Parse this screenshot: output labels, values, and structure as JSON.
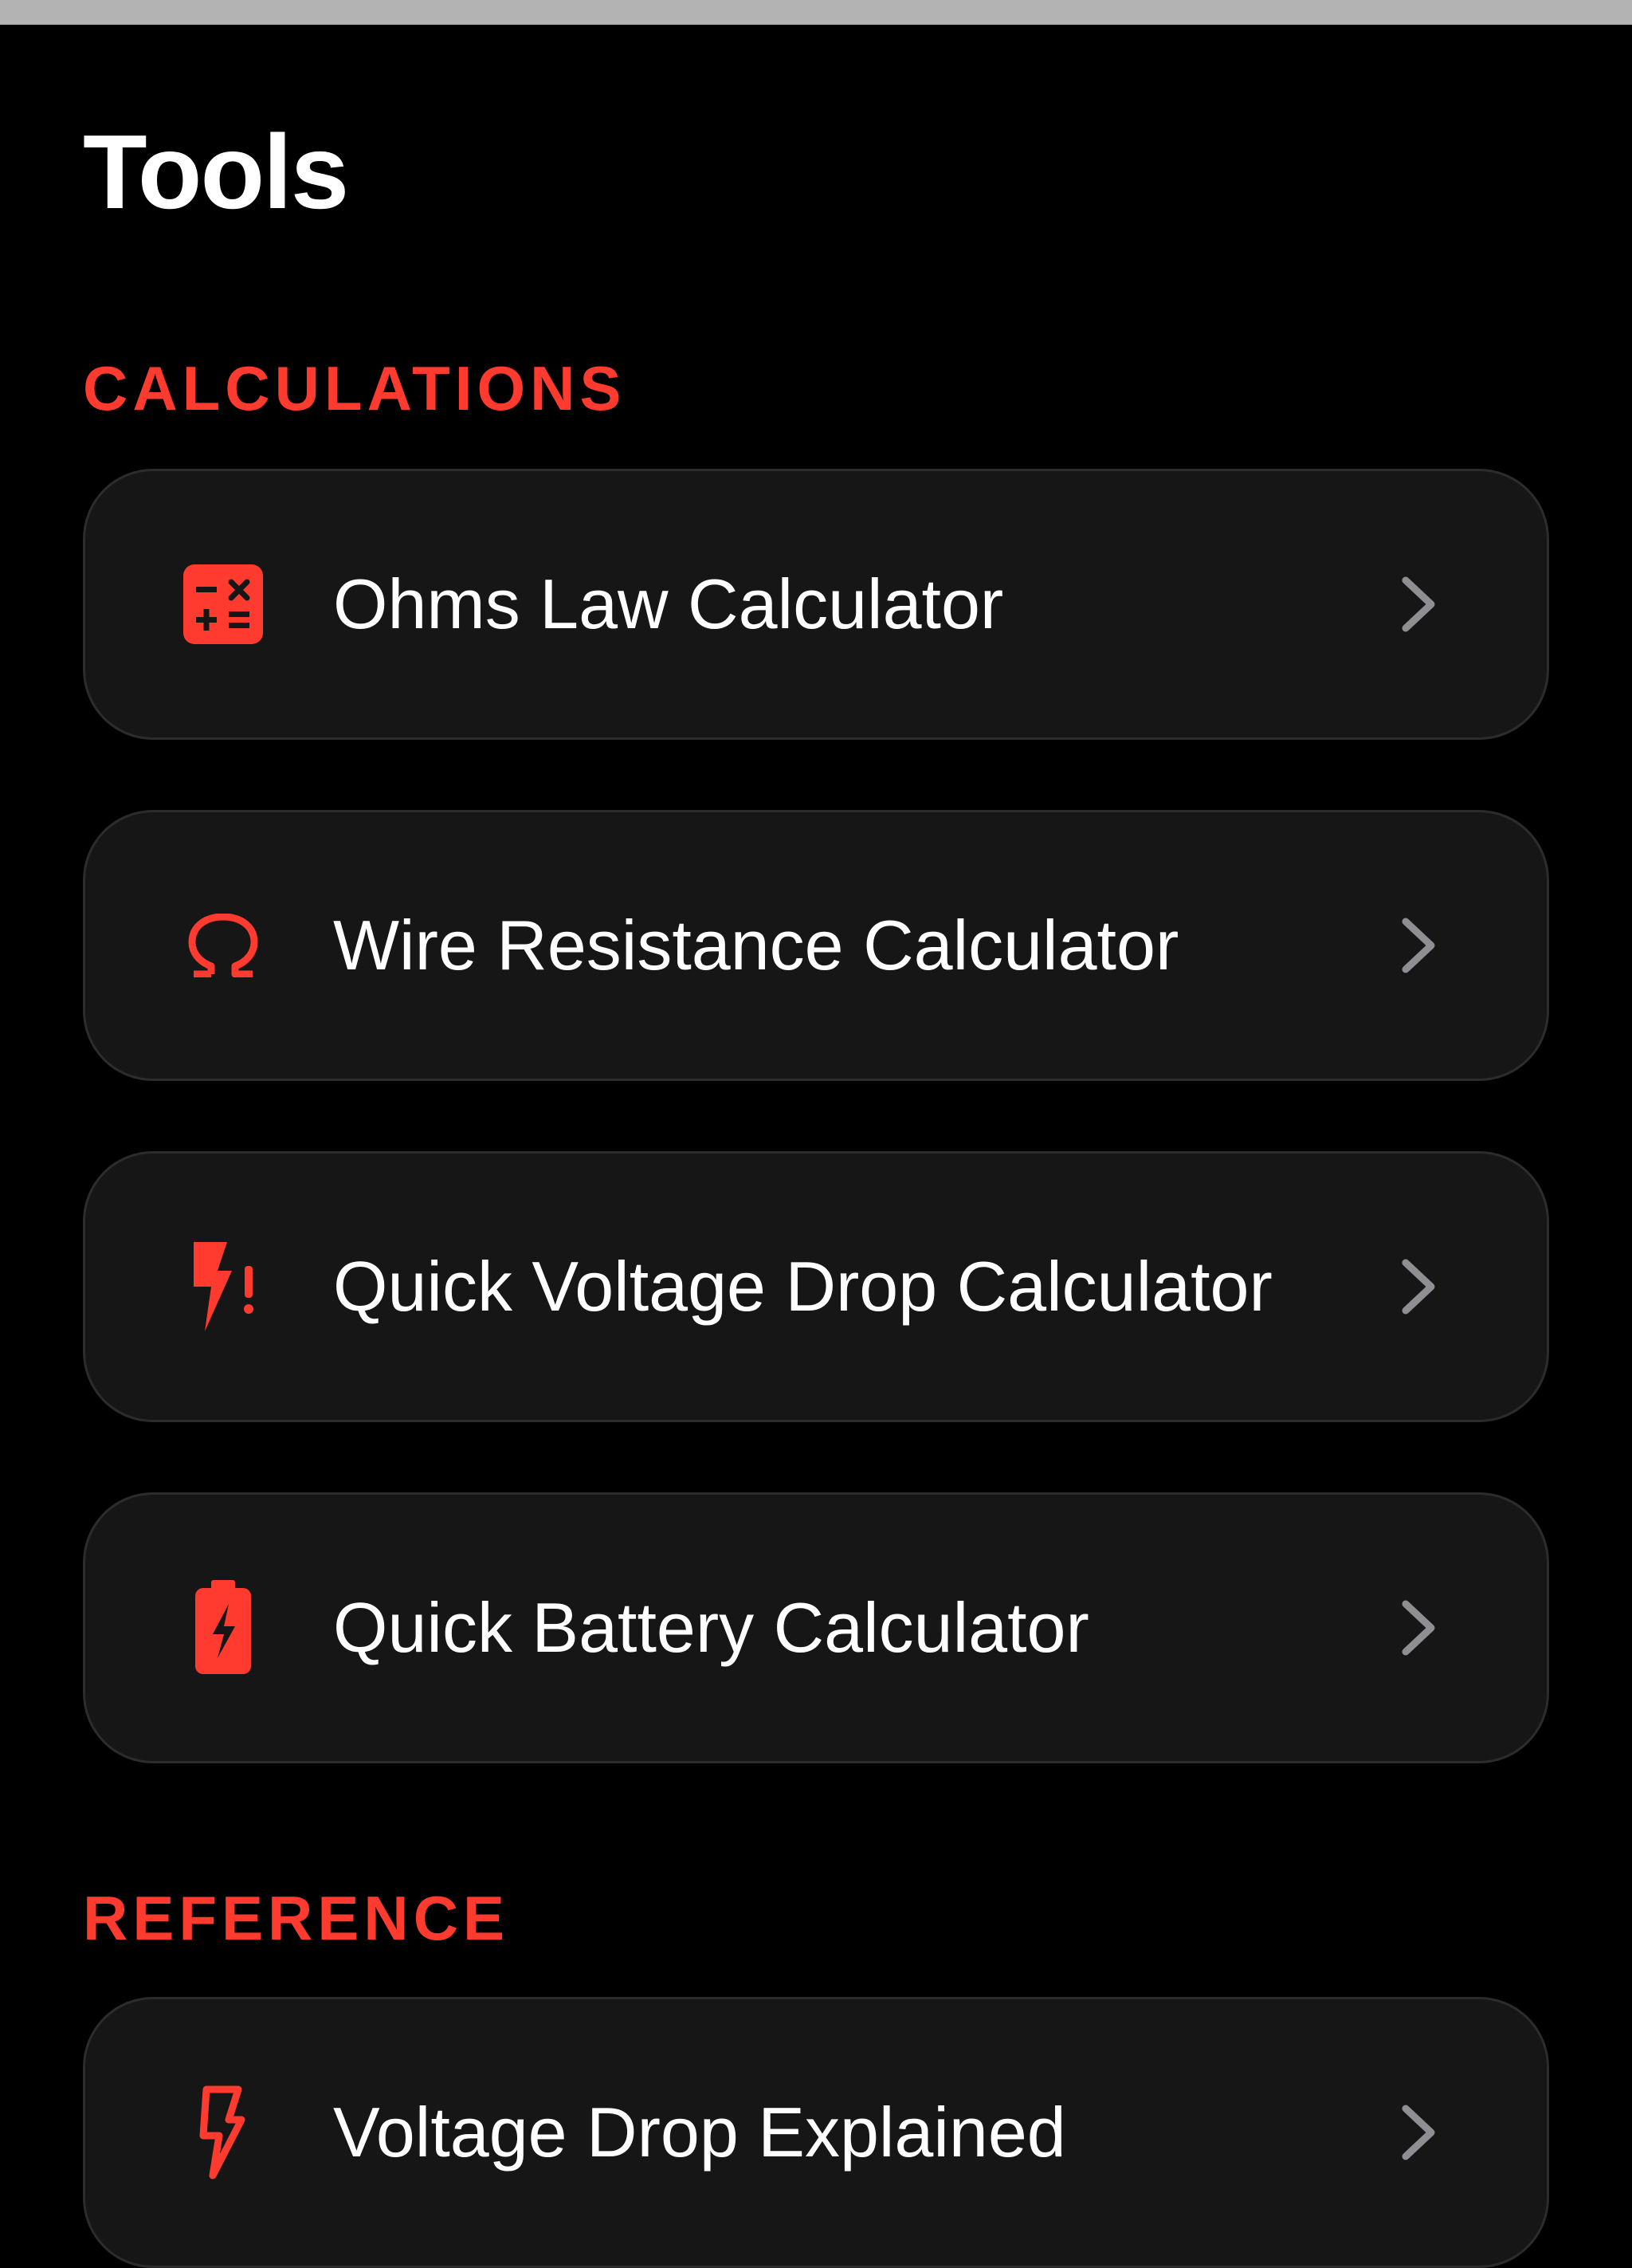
{
  "page": {
    "title": "Tools"
  },
  "sections": [
    {
      "header": "CALCULATIONS",
      "items": [
        {
          "label": "Ohms Law Calculator",
          "icon": "calculator-icon"
        },
        {
          "label": "Wire Resistance Calculator",
          "icon": "omega-icon"
        },
        {
          "label": "Quick Voltage Drop Calculator",
          "icon": "bolt-warning-icon"
        },
        {
          "label": "Quick Battery Calculator",
          "icon": "battery-bolt-icon"
        }
      ]
    },
    {
      "header": "REFERENCE",
      "items": [
        {
          "label": "Voltage Drop Explained",
          "icon": "bolt-outline-icon"
        }
      ]
    }
  ],
  "colors": {
    "accent": "#ff3b30",
    "background": "#000000",
    "card": "#161616",
    "card_border": "#2c2c2e",
    "chevron": "#8e8e93",
    "text": "#ffffff"
  }
}
